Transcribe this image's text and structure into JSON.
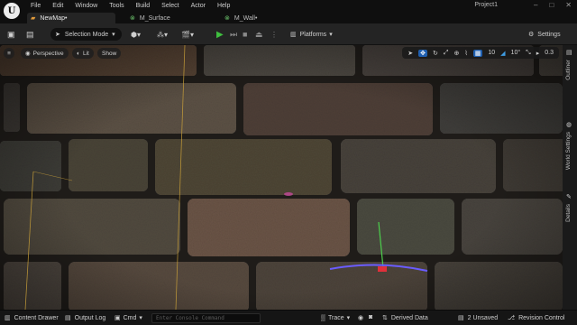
{
  "menubar": {
    "logo": "U",
    "items": [
      "File",
      "Edit",
      "Window",
      "Tools",
      "Build",
      "Select",
      "Actor",
      "Help"
    ],
    "project": "Project1",
    "window_controls": [
      "–",
      "□",
      "✕"
    ]
  },
  "tabs": [
    {
      "label": "NewMap•",
      "icon": "map-icon",
      "active": true
    },
    {
      "label": "M_Surface",
      "icon": "material-icon",
      "active": false
    },
    {
      "label": "M_Wall•",
      "icon": "material-icon",
      "active": false
    }
  ],
  "toolbar": {
    "selection_mode": "Selection Mode",
    "platforms": "Platforms",
    "settings": "Settings"
  },
  "viewport": {
    "perspective": "Perspective",
    "lit": "Lit",
    "show": "Show",
    "grid_snap": "10",
    "rotation_snap": "10°",
    "camera_speed": "0.3"
  },
  "side_tabs": [
    "Outliner",
    "World Settings",
    "Details"
  ],
  "statusbar": {
    "content_drawer": "Content Drawer",
    "output_log": "Output Log",
    "cmd": "Cmd",
    "console_placeholder": "Enter Console Command",
    "trace": "Trace",
    "derived_data": "Derived Data",
    "unsaved": "2 Unsaved",
    "revision_control": "Revision Control"
  },
  "colors": {
    "play": "#3fbf3f",
    "selection": "#1f5fb0",
    "gizmo_arc": "#6a5cff"
  }
}
